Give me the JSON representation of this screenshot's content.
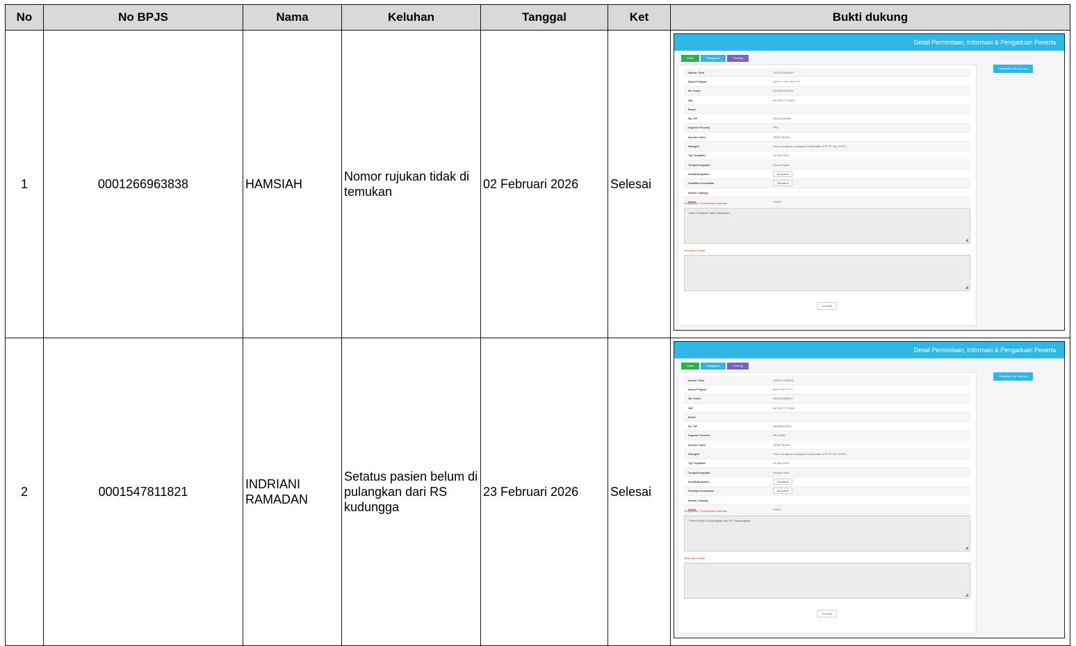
{
  "table": {
    "headers": {
      "no": "No",
      "bpjs": "No BPJS",
      "nama": "Nama",
      "keluhan": "Keluhan",
      "tanggal": "Tanggal",
      "ket": "Ket",
      "bukti": "Bukti dukung"
    },
    "rows": [
      {
        "no": "1",
        "bpjs": "0001266963838",
        "nama": "HAMSIAH",
        "keluhan": "Nomor rujukan tidak di temukan",
        "tanggal": "02 Februari 2026",
        "ket": "Selesai",
        "evidence": {
          "title": "Detail Permintaan, Informasi & Pengaduan Peserta",
          "tabs": [
            "Detail",
            "Tanggapan",
            "Tracking"
          ],
          "journey_label": "Tampilkan List Journey",
          "fields": [
            {
              "label": "Nomor Tiket",
              "value": "202511.0460940"
            },
            {
              "label": "Nama Pelapor",
              "value": "HU****** M*** AL******"
            },
            {
              "label": "No. Kartu",
              "value": "0003021034004"
            },
            {
              "label": "NIK",
              "value": "647207******0002"
            },
            {
              "label": "Email",
              "value": "-"
            },
            {
              "label": "No. HP",
              "value": "082211149081"
            },
            {
              "label": "Segmen Peserta",
              "value": "PPU"
            },
            {
              "label": "Sumber Data",
              "value": "TATAP MUKA"
            },
            {
              "label": "Kategori",
              "value": "Cara mengakses pelayanan kesehatan di FKTP dan FKRTL"
            },
            {
              "label": "Tgl. Kejadian",
              "value": "03 Nov 2025"
            },
            {
              "label": "Tempat Kejadian",
              "value": "Rumah Sakit"
            },
            {
              "label": "Kota/Kabupaten",
              "value": "Tampilkan"
            },
            {
              "label": "Fasilitas Kesehatan",
              "value": "Tampilkan"
            },
            {
              "label": "Kantor Cabang",
              "value": ""
            },
            {
              "label": "Kanal",
              "value": "FKRTL"
            }
          ],
          "complaint_label": "Pengaduan / Permintaan Informasi",
          "complaint_text": "Nomor Rujukan Tidak Ditemukan.",
          "info_label": "Informasi Gencitt",
          "back_label": "Kembali"
        }
      },
      {
        "no": "2",
        "bpjs": "0001547811821",
        "nama": "INDRIANI RAMADAN",
        "keluhan": "Setatus pasien belum di pulangkan dari RS kudungga",
        "tanggal": "23 Februari 2026",
        "ket": "Selesai",
        "evidence": {
          "title": "Detail Permintaan, Informasi & Pengaduan Peserta",
          "tabs": [
            "Detail",
            "Tanggapan",
            "Tracking"
          ],
          "journey_label": "Tampilkan List Journey",
          "fields": [
            {
              "label": "Nomor Tiket",
              "value": "202511.0460026"
            },
            {
              "label": "Nama Pelapor",
              "value": "M3*** M*********"
            },
            {
              "label": "No. Kartu",
              "value": "0001261588957"
            },
            {
              "label": "NIK",
              "value": "647104******0001"
            },
            {
              "label": "Email",
              "value": "-"
            },
            {
              "label": "No. HP",
              "value": "082285543161"
            },
            {
              "label": "Segmen Peserta",
              "value": "PBI APBD"
            },
            {
              "label": "Sumber Data",
              "value": "TATAP MUKA"
            },
            {
              "label": "Kategori",
              "value": "Cara mengakses pelayanan kesehatan di FKTP dan FKRTL"
            },
            {
              "label": "Tgl. Kejadian",
              "value": "21 Nov 2025"
            },
            {
              "label": "Tempat Kejadian",
              "value": "Rumah Sakit"
            },
            {
              "label": "Kota/Kabupaten",
              "value": "Tampilkan"
            },
            {
              "label": "Fasilitas Kesehatan",
              "value": "Tampilkan"
            },
            {
              "label": "Kantor Cabang",
              "value": ""
            },
            {
              "label": "Kanal",
              "value": "FKRTL"
            }
          ],
          "complaint_label": "Pengaduan / Permintaan Informasi",
          "complaint_text": "Pasien Belum di pulangkan dari RS. Bhayangkara",
          "info_label": "Informasi Gencitt",
          "back_label": "Kembali"
        }
      }
    ]
  },
  "colors": {
    "header_bg": "#d9d9d9",
    "topbar": "#2fb8e6",
    "tab_detail": "#29b24a",
    "tab_tracking": "#7a5fc8",
    "label_red": "#c0392b"
  }
}
